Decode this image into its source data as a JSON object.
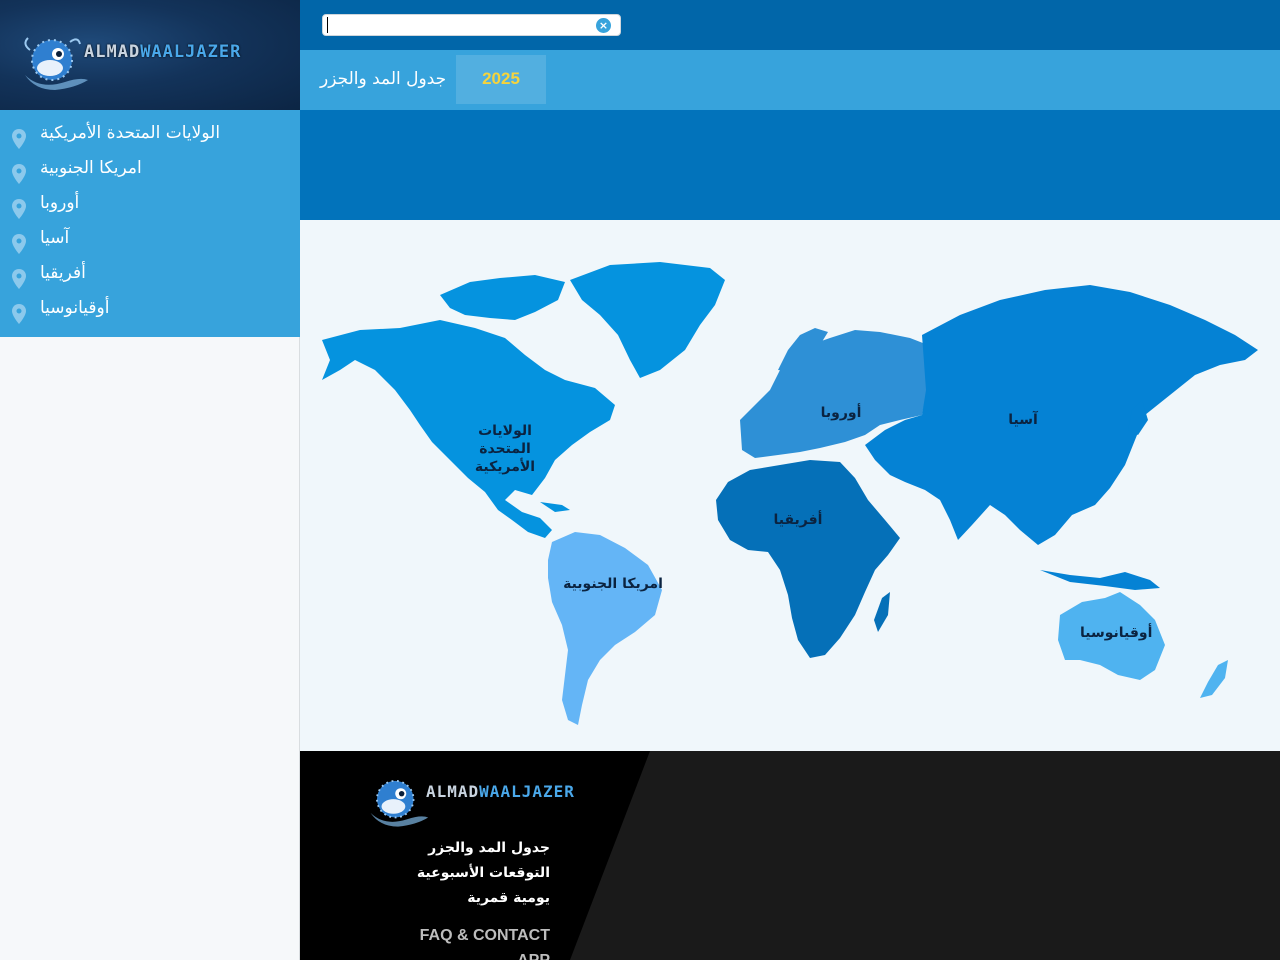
{
  "brand": {
    "logo_text_a": "ALMAD",
    "logo_text_b": "WAALJAZER"
  },
  "search": {
    "value": "",
    "placeholder": ""
  },
  "nav": {
    "items": [
      {
        "label": "الولايات المتحدة الأمريكية",
        "icon": "map-pin-icon"
      },
      {
        "label": "امريكا الجنوبية",
        "icon": "map-pin-icon"
      },
      {
        "label": "أوروبا",
        "icon": "map-pin-icon"
      },
      {
        "label": "آسيا",
        "icon": "map-pin-icon"
      },
      {
        "label": "أفريقيا",
        "icon": "map-pin-icon"
      },
      {
        "label": "أوقيانوسيا",
        "icon": "map-pin-icon"
      }
    ]
  },
  "header": {
    "subtitle": "جدول المد والجزر",
    "year": "2025"
  },
  "map": {
    "regions": {
      "usa": "الولايات المتحدة الأمريكية",
      "south_america": "امريكا الجنوبية",
      "europe": "أوروبا",
      "asia": "آسيا",
      "africa": "أفريقيا",
      "oceania": "أوقيانوسيا"
    },
    "colors": {
      "north_america": "#0593df",
      "south_america": "#64b5f6",
      "europe": "#2e90d6",
      "asia": "#0582d4",
      "africa": "#0570b8",
      "oceania": "#4fb3f0"
    }
  },
  "footer": {
    "links": [
      "جدول المد والجزر",
      "التوقعات الأسبوعية",
      "يومية قمرية"
    ],
    "faq": "FAQ & CONTACT",
    "app": "APP"
  },
  "colors": {
    "topbar": "#0166a9",
    "subbar": "#37a3dc",
    "band": "#0273bb",
    "year_accent": "#f5d33c"
  }
}
